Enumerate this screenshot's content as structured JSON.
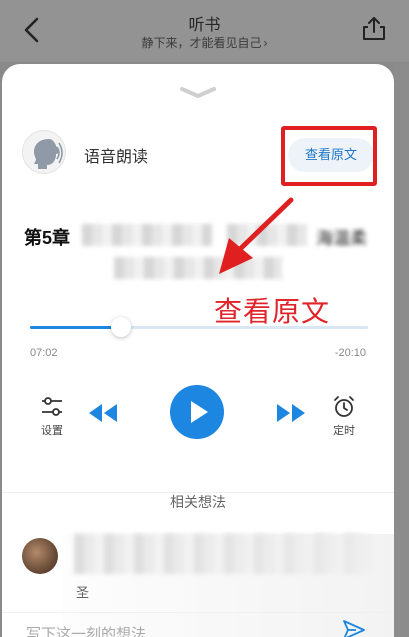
{
  "header": {
    "title": "听书",
    "subtitle": "静下来，才能看见自己",
    "subtitle_chevron": "›"
  },
  "player": {
    "voice_name": "语音朗读",
    "view_original_label": "查看原文",
    "chapter_title": "第5章",
    "chapter_tail": "海温柔",
    "annotation": "查看原文",
    "progress": 0.27,
    "elapsed": "07:02",
    "remaining": "-20:10",
    "settings_label": "设置",
    "timer_label": "定时"
  },
  "thoughts": {
    "section_title": "相关想法",
    "comment_name": "圣",
    "input_placeholder": "写下这一刻的想法"
  },
  "colors": {
    "accent": "#1c86e0",
    "highlight": "#e02020",
    "annotation": "#e0242a"
  }
}
